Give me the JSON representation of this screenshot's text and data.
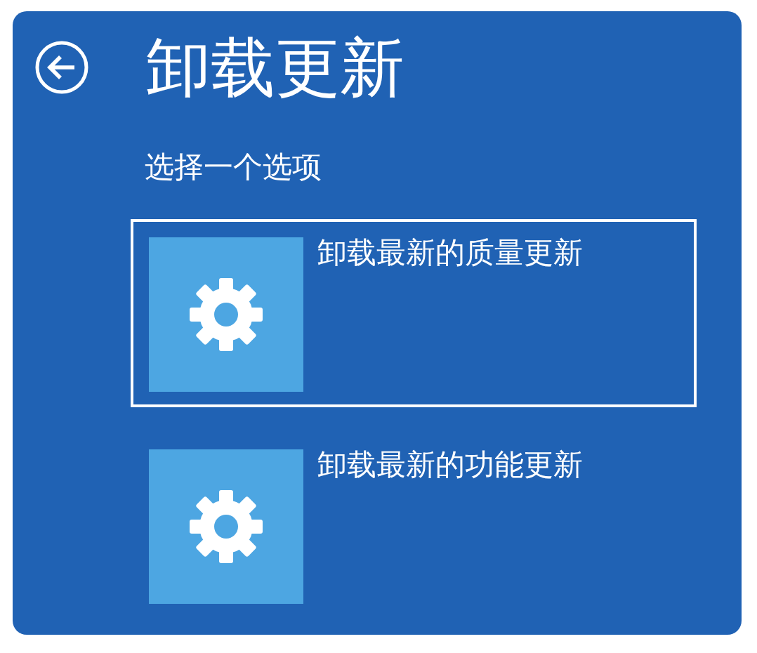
{
  "title": "卸载更新",
  "subtitle": "选择一个选项",
  "options": [
    {
      "label": "卸载最新的质量更新",
      "selected": true
    },
    {
      "label": "卸载最新的功能更新",
      "selected": false
    }
  ]
}
